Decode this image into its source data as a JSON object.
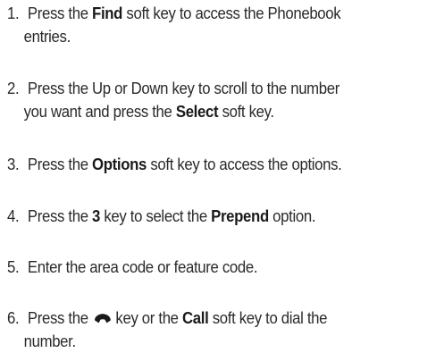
{
  "steps": [
    {
      "number": "1.",
      "pre": "Press the",
      "key": "Find",
      "post": "soft key to access the Phonebook",
      "cont": "entries."
    },
    {
      "number": "2.",
      "line1": "Press the Up or Down key to scroll to the number",
      "pre": "you want and press the",
      "key": "Select",
      "post": "soft key."
    },
    {
      "number": "3.",
      "pre": "Press the",
      "key": "Options",
      "post": "soft key to access the options."
    },
    {
      "number": "4.",
      "pre": "Press the",
      "key": "3",
      "mid": "key to select the",
      "key2": "Prepend",
      "post": "option."
    },
    {
      "number": "5.",
      "text": "Enter the area code or feature code."
    },
    {
      "number": "6.",
      "pre": "Press the",
      "icon": "send-key-icon",
      "mid": "key or the",
      "key": "Call",
      "post": "soft key to dial the",
      "cont": "number."
    }
  ]
}
